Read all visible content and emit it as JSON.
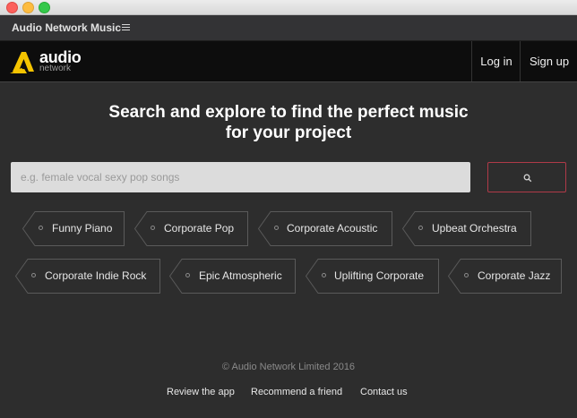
{
  "app": {
    "title": "Audio Network Music"
  },
  "logo": {
    "line1": "audio",
    "line2": "network",
    "mark_color": "#f5c400"
  },
  "nav": {
    "login": "Log in",
    "signup": "Sign up"
  },
  "hero": {
    "line1": "Search and explore to find the perfect music",
    "line2": "for your project"
  },
  "search": {
    "placeholder": "e.g. female vocal sexy pop songs",
    "button_icon": "search-icon",
    "button_border_color": "#b03a48"
  },
  "tags": [
    "Funny Piano",
    "Corporate Pop",
    "Corporate Acoustic",
    "Upbeat Orchestra",
    "Corporate Indie Rock",
    "Epic Atmospheric",
    "Uplifting Corporate",
    "Corporate Jazz"
  ],
  "footer": {
    "copyright": "© Audio Network Limited 2016",
    "links": [
      "Review the app",
      "Recommend a friend",
      "Contact us"
    ]
  }
}
